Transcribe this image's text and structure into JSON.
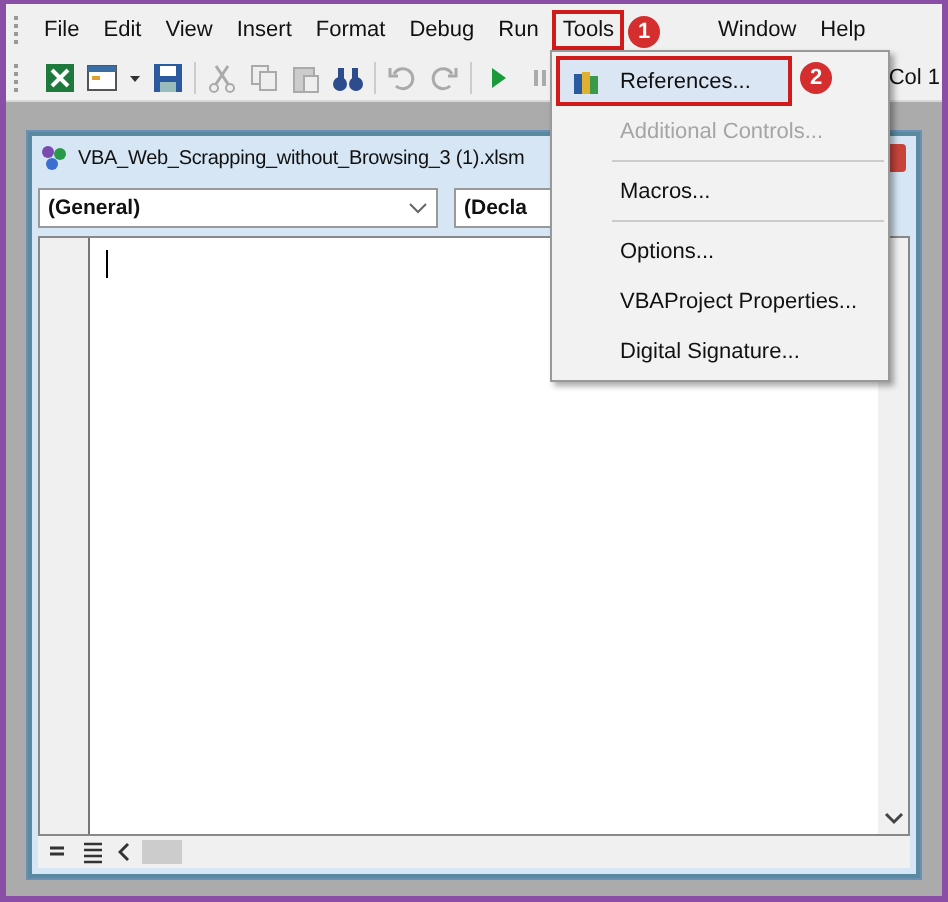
{
  "menu_bar": [
    {
      "label": "File",
      "selected": false
    },
    {
      "label": "Edit",
      "selected": false
    },
    {
      "label": "View",
      "selected": false
    },
    {
      "label": "Insert",
      "selected": false
    },
    {
      "label": "Format",
      "selected": false
    },
    {
      "label": "Debug",
      "selected": false
    },
    {
      "label": "Run",
      "selected": false
    },
    {
      "label": "Tools",
      "selected": true,
      "callout": "1"
    },
    {
      "label": "Window",
      "selected": false
    },
    {
      "label": "Help",
      "selected": false
    }
  ],
  "toolbar": {
    "position": "Col 1"
  },
  "tools_menu": [
    {
      "kind": "item",
      "label": "References...",
      "disabled": false,
      "highlighted": true,
      "callout": "2",
      "icon": true
    },
    {
      "kind": "item",
      "label": "Additional Controls...",
      "disabled": true,
      "highlighted": false
    },
    {
      "kind": "separator"
    },
    {
      "kind": "item",
      "label": "Macros...",
      "disabled": false,
      "highlighted": false
    },
    {
      "kind": "separator"
    },
    {
      "kind": "item",
      "label": "Options...",
      "disabled": false,
      "highlighted": false
    },
    {
      "kind": "item",
      "label": "VBAProject Properties...",
      "disabled": false,
      "highlighted": false
    },
    {
      "kind": "item",
      "label": "Digital Signature...",
      "disabled": false,
      "highlighted": false
    }
  ],
  "code_window": {
    "title": "VBA_Web_Scrapping_without_Browsing_3 (1).xlsm",
    "object_dropdown": "(General)",
    "procedure_dropdown": "(Decla"
  }
}
